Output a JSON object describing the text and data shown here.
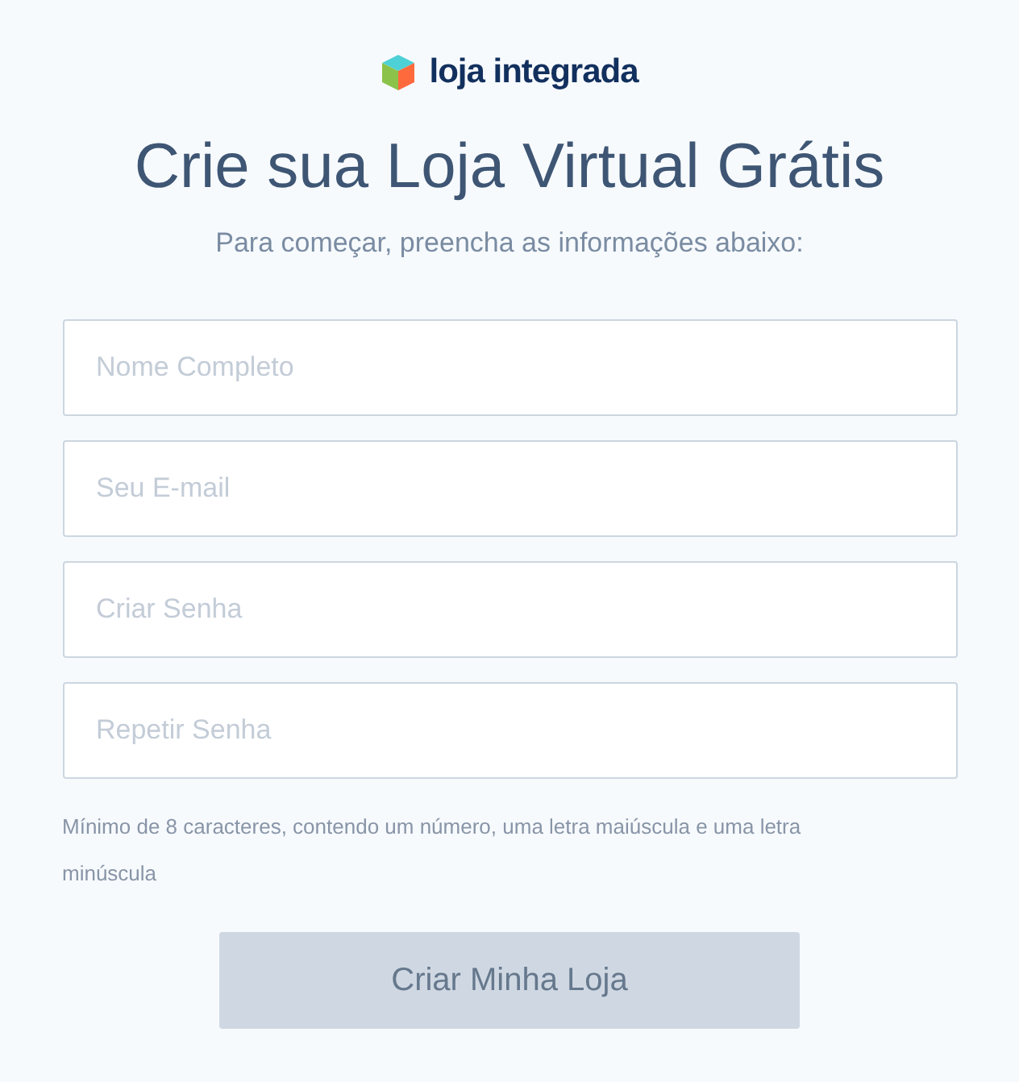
{
  "logo": {
    "text": "loja integrada"
  },
  "heading": "Crie sua Loja Virtual Grátis",
  "subheading": "Para começar, preencha as informações abaixo:",
  "fields": [
    {
      "placeholder": "Nome Completo"
    },
    {
      "placeholder": "Seu E-mail"
    },
    {
      "placeholder": "Criar Senha"
    },
    {
      "placeholder": "Repetir Senha"
    }
  ],
  "hint": "Mínimo de 8 caracteres, contendo um número, uma letra maiúscula e uma letra minúscula",
  "submit": {
    "label": "Criar Minha Loja",
    "disabled": true
  }
}
